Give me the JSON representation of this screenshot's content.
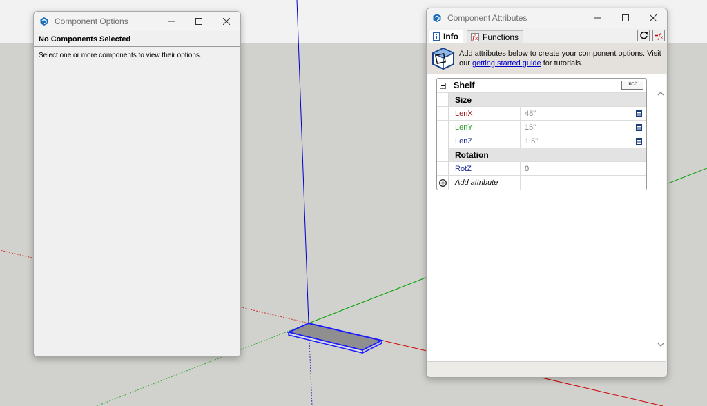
{
  "component_options": {
    "title": "Component Options",
    "header": "No Components Selected",
    "message": "Select one or more components to view their options."
  },
  "component_attributes": {
    "title": "Component Attributes",
    "tabs": [
      {
        "label": "Info",
        "icon": "info-icon",
        "active": true
      },
      {
        "label": "Functions",
        "icon": "function-icon",
        "active": false
      }
    ],
    "toolbar": {
      "refresh_icon": "refresh-icon",
      "formula_icon": "formula-icon"
    },
    "banner": {
      "text_before": "Add attributes below to create your component options. Visit our ",
      "link_text": "getting started guide",
      "text_after": " for tutorials."
    },
    "component": {
      "name": "Shelf",
      "units": "inch",
      "sections": [
        {
          "name": "Size",
          "attributes": [
            {
              "name": "LenX",
              "value": "48\"",
              "color": "#a01818"
            },
            {
              "name": "LenY",
              "value": "15\"",
              "color": "#2ea02e"
            },
            {
              "name": "LenZ",
              "value": "1.5\"",
              "color": "#1a2a9a"
            }
          ]
        },
        {
          "name": "Rotation",
          "attributes": [
            {
              "name": "RotZ",
              "value": "0",
              "color": "#1a2a9a"
            }
          ]
        }
      ],
      "add_attribute_label": "Add attribute"
    }
  },
  "colors": {
    "axis_blue": "#0000cc",
    "axis_red": "#cc0000",
    "axis_green": "#00a000",
    "selection_blue": "#1a1aff"
  }
}
